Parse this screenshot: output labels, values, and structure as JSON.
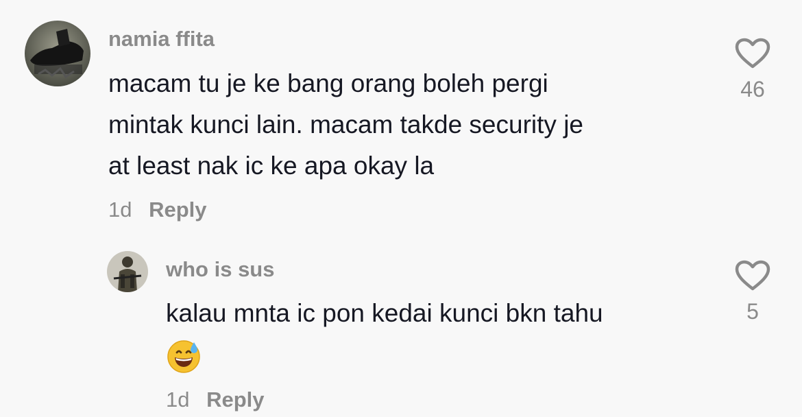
{
  "comments": [
    {
      "username": "namia ffita",
      "text_lines": [
        "macam tu je ke bang orang boleh pergi",
        "mintak kunci lain. macam takde security je",
        "at least nak ic ke apa okay la"
      ],
      "time": "1d",
      "reply_label": "Reply",
      "likes": "46",
      "avatar_icon": "boot-photo-avatar"
    },
    {
      "username": "who is sus",
      "text_lines": [
        "kalau mnta ic pon kedai kunci bkn tahu"
      ],
      "emoji": "grinning-face-with-sweat-emoji",
      "time": "1d",
      "reply_label": "Reply",
      "likes": "5",
      "avatar_icon": "soldier-photo-avatar"
    }
  ],
  "colors": {
    "background": "#f8f8f8",
    "text": "#161823",
    "muted": "#8a8a8a"
  }
}
